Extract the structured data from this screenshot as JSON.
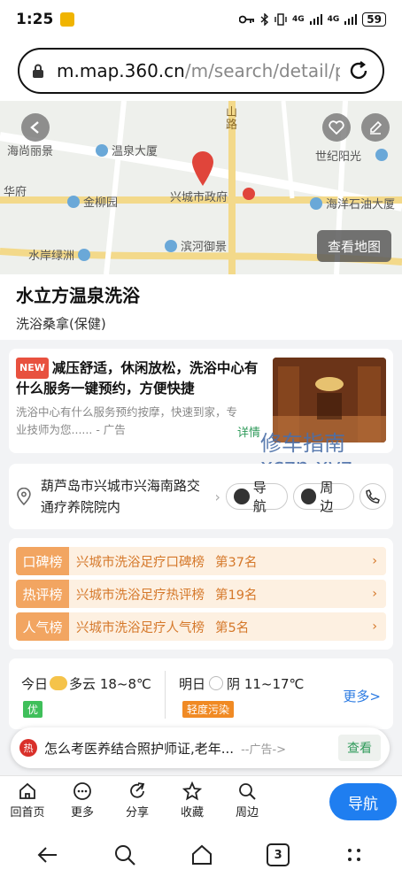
{
  "status_bar": {
    "time": "1:25",
    "battery": "59",
    "signal_text_1": "4G",
    "signal_text_2": "4G"
  },
  "browser": {
    "url_host": "m.map.360.cn",
    "url_path": "/m/search/detail/pid"
  },
  "map": {
    "labels": [
      "海尚丽景",
      "温泉大厦",
      "山",
      "路",
      "世纪阳光",
      "华府",
      "金柳园",
      "兴城市政府",
      "海洋石油大厦",
      "水岸绿洲",
      "滨河御景"
    ],
    "view_map_label": "查看地图"
  },
  "place": {
    "name": "水立方温泉洗浴",
    "category": "洗浴桑拿(保健)"
  },
  "ad": {
    "new_tag": "NEW",
    "headline": "减压舒适，休闲放松，洗浴中心有什么服务一键预约，方便快捷",
    "description": "洗浴中心有什么服务预约按摩，快速到家，专业技师为您...... - 广告",
    "more_label": "详情"
  },
  "watermark": {
    "line1": "修车指南",
    "line2": "xczn.xyz"
  },
  "address": {
    "text": "葫芦岛市兴城市兴海南路交通疗养院院内",
    "navigate_label": "导航",
    "nearby_label": "周边"
  },
  "rankings": [
    {
      "tag": "口碑榜",
      "title": "兴城市洗浴足疗口碑榜",
      "rank": "第37名"
    },
    {
      "tag": "热评榜",
      "title": "兴城市洗浴足疗热评榜",
      "rank": "第19名"
    },
    {
      "tag": "人气榜",
      "title": "兴城市洗浴足疗人气榜",
      "rank": "第5名"
    }
  ],
  "weather": {
    "today": {
      "day": "今日",
      "condition": "多云",
      "temp": "18~8℃",
      "aqi": "优",
      "aqi_color": "#3fbf5a"
    },
    "tomorrow": {
      "day": "明日",
      "condition": "阴",
      "temp": "11~17℃",
      "aqi": "轻度污染",
      "aqi_color": "#f08a24"
    },
    "more_label": "更多>"
  },
  "banner": {
    "hot": "热",
    "text": "怎么考医养结合照护师证,老年...",
    "ad": "--广告->",
    "view_label": "查看"
  },
  "toolbar": {
    "items": [
      {
        "label": "回首页",
        "icon": "home-icon"
      },
      {
        "label": "更多",
        "icon": "more-icon"
      },
      {
        "label": "分享",
        "icon": "share-icon"
      },
      {
        "label": "收藏",
        "icon": "star-icon"
      },
      {
        "label": "周边",
        "icon": "search-icon"
      }
    ],
    "navigate_label": "导航"
  },
  "system_nav": {
    "tabs_count": "3"
  },
  "colors": {
    "accent": "#1f7ef0",
    "rank_bg": "#fdf0e1",
    "rank_tag": "#f2a561",
    "rank_text": "#d5782a",
    "green": "#2f9a5a"
  }
}
